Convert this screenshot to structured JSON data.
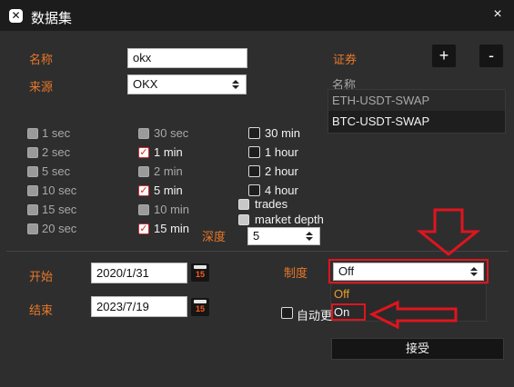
{
  "window": {
    "title": "数据集",
    "close": "×",
    "app_icon": "✕"
  },
  "form": {
    "name_label": "名称",
    "name_value": "okx",
    "source_label": "来源",
    "source_value": "OKX",
    "securities_label": "证券",
    "add_label": "+",
    "remove_label": "-",
    "list_header": "名称",
    "securities": [
      "ETH-USDT-SWAP",
      "BTC-USDT-SWAP"
    ]
  },
  "intervals": {
    "col1": [
      "1 sec",
      "2 sec",
      "5 sec",
      "10 sec",
      "15 sec",
      "20 sec"
    ],
    "col2": [
      "30 sec",
      "1 min",
      "2 min",
      "5 min",
      "10 min",
      "15 min"
    ],
    "col3": [
      "30 min",
      "1 hour",
      "2 hour",
      "4 hour"
    ],
    "trades": "trades",
    "market_depth": "market depth",
    "depth_label": "深度",
    "depth_value": "5"
  },
  "dates": {
    "start_label": "开始",
    "start_value": "2020/1/31",
    "end_label": "结束",
    "end_value": "2023/7/19",
    "cal_day": "15"
  },
  "regime": {
    "label": "制度",
    "selected": "Off",
    "options": [
      "Off",
      "On"
    ],
    "auto_update_label": "自动更"
  },
  "accept_label": "接受",
  "colors": {
    "accent_orange": "#e8782a",
    "highlight_red": "#e0141e"
  },
  "icons": {
    "down_arrow": "arrow-down-annotation",
    "left_arrow": "arrow-left-annotation"
  }
}
